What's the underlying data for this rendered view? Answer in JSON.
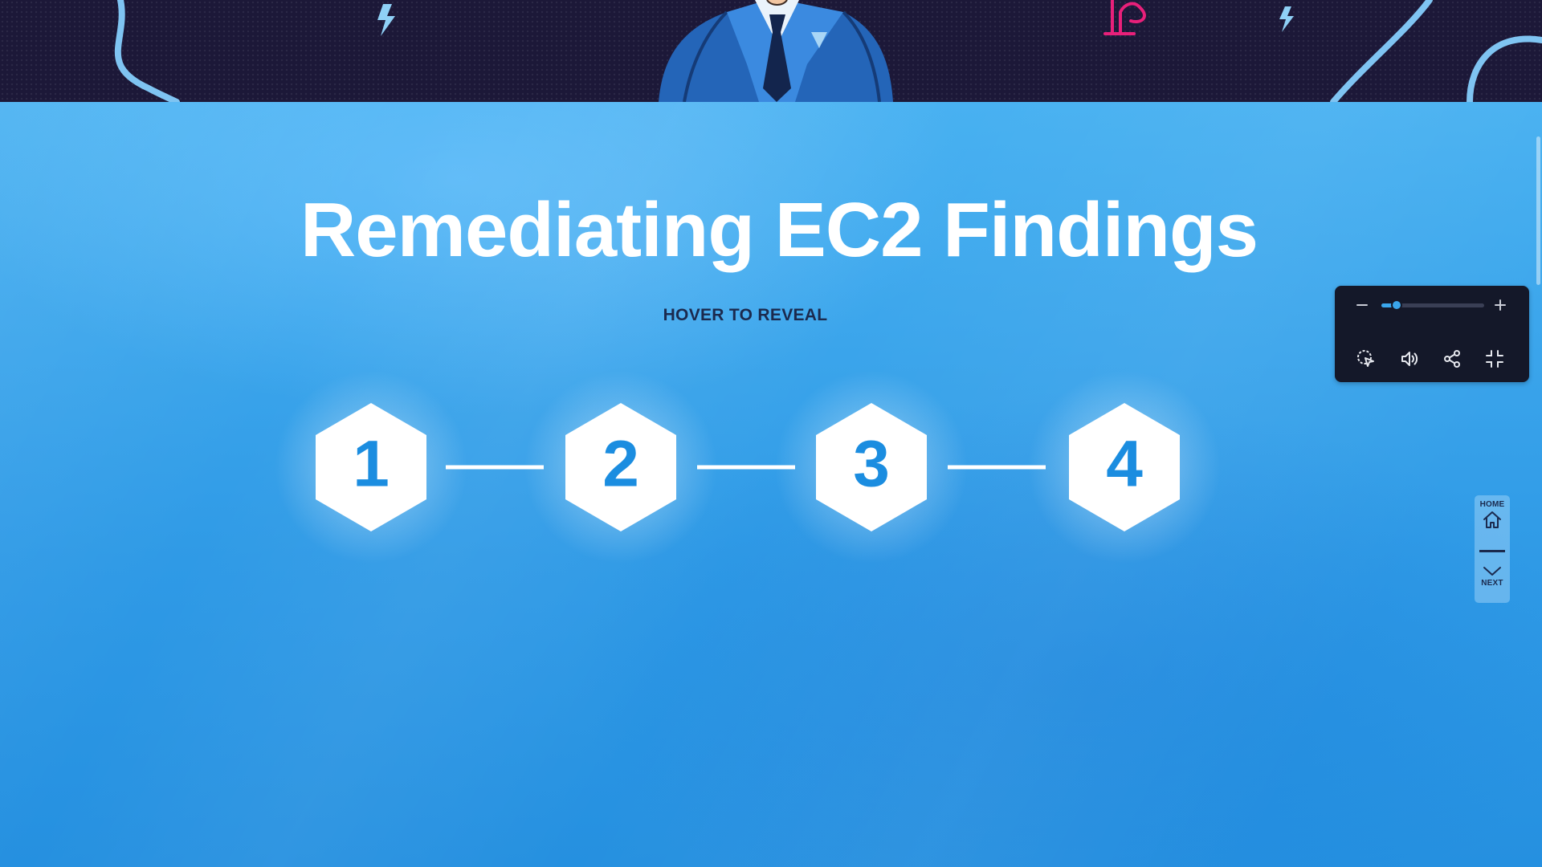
{
  "hero": {
    "title": "Remediating EC2 Findings",
    "hint": "HOVER TO REVEAL"
  },
  "steps": [
    {
      "label": "1"
    },
    {
      "label": "2"
    },
    {
      "label": "3"
    },
    {
      "label": "4"
    }
  ],
  "media_controls": {
    "zoom_level_fraction": 0.15,
    "icons": [
      "zoom-out-icon",
      "zoom-in-icon",
      "cursor-icon",
      "volume-icon",
      "share-icon",
      "exit-fullscreen-icon"
    ]
  },
  "side_nav": {
    "home_label": "HOME",
    "next_label": "NEXT"
  },
  "colors": {
    "background_blue": "#3aa6ec",
    "band_dark": "#1c1838",
    "accent_pink": "#e8207a",
    "number_blue": "#1b8de0",
    "dark_text": "#1b2a4e"
  }
}
